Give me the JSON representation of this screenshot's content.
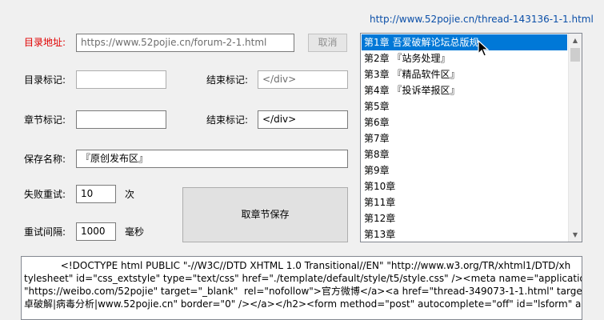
{
  "header": {
    "thread_link": "http://www.52pojie.cn/thread-143136-1-1.html"
  },
  "form": {
    "dir_address_label": "目录地址:",
    "dir_address_value": "https://www.52pojie.cn/forum-2-1.html",
    "cancel_label": "取消",
    "dir_mark_label": "目录标记:",
    "dir_mark_value": "",
    "dir_end_label": "结束标记:",
    "dir_end_placeholder": "</div>",
    "chapter_mark_label": "章节标记:",
    "chapter_mark_value": "",
    "chapter_end_label": "结束标记:",
    "chapter_end_value": "</div>",
    "save_name_label": "保存名称:",
    "save_name_value": "『原创发布区』",
    "retry_label": "失败重试:",
    "retry_value": "10",
    "retry_unit": "次",
    "interval_label": "重试间隔:",
    "interval_value": "1000",
    "interval_unit": "毫秒",
    "fetch_save_label": "取章节保存"
  },
  "chapters": {
    "items": [
      "第1章 吾爱破解论坛总版规",
      "第2章 『站务处理』",
      "第3章 『精品软件区』",
      "第4章 『投诉举报区』",
      "第5章",
      "第6章",
      "第7章",
      "第8章",
      "第9章",
      "第10章",
      "第11章",
      "第12章",
      "第13章"
    ],
    "selected_index": 0
  },
  "source_text": {
    "lines": [
      "            <!DOCTYPE html PUBLIC \"-//W3C//DTD XHTML 1.0 Transitional//EN\" \"http://www.w3.org/TR/xhtml1/DTD/xh",
      "tylesheet\" id=\"css_extstyle\" type=\"text/css\" href=\"./template/default/style/t5/style.css\" /><meta name=\"application-n",
      "\"https://weibo.com/52pojie\" target=\"_blank\"  rel=\"nofollow\">官方微博</a><a href=\"thread-349073-1-1.html\" target=",
      "卓破解|病毒分析|www.52pojie.cn\" border=\"0\" /></a></h2><form method=\"post\" autocomplete=\"off\" id=\"lsform\" ac"
    ]
  }
}
